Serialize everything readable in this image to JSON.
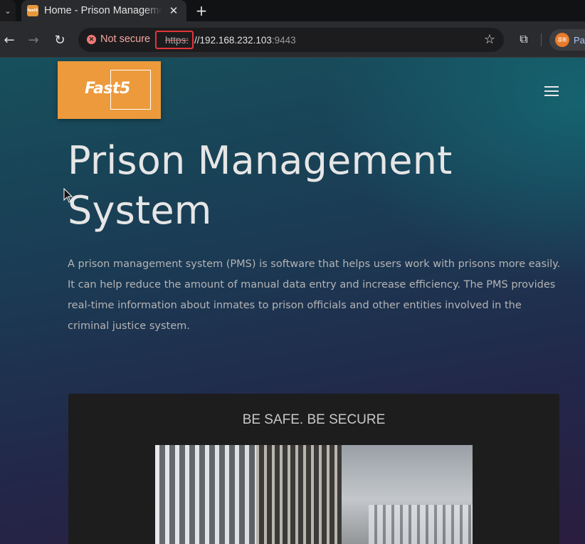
{
  "browser": {
    "tab": {
      "favicon_text": "fast5",
      "title": "Home - Prison Management System"
    },
    "security_label": "Not secure",
    "url": {
      "scheme": "https:",
      "separator": "//",
      "host": "192.168.232.103",
      "port": ":9443"
    },
    "profile": {
      "avatar_text": "凛彬",
      "label": "Pa"
    }
  },
  "page": {
    "logo_text": "Fast5",
    "hero_title_line1": "Prison Management",
    "hero_title_line2": "System",
    "hero_description": "A prison management system (PMS) is software that helps users work with prisons more easily. It can help reduce the amount of manual data entry and increase efficiency. The PMS provides real-time information about inmates to prison officials and other entities involved in the criminal justice system.",
    "card_title": "BE SAFE. BE SECURE"
  },
  "colors": {
    "logo_bg": "#ec9a3b",
    "highlight_box": "#e3363d",
    "card_bg": "#1d1d1d"
  }
}
